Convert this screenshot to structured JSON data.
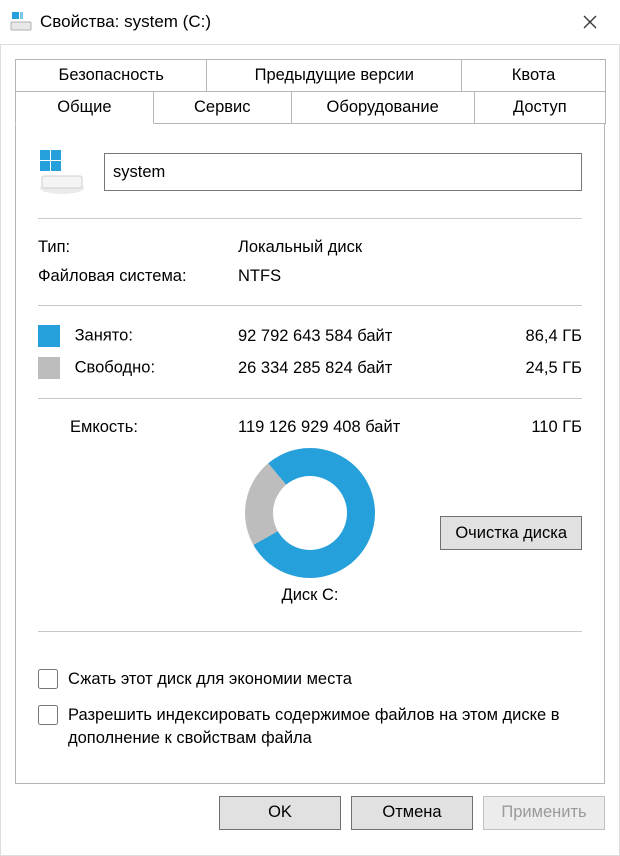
{
  "window": {
    "title": "Свойства: system (C:)"
  },
  "tabs_row1": [
    {
      "label": "Безопасность"
    },
    {
      "label": "Предыдущие версии"
    },
    {
      "label": "Квота"
    }
  ],
  "tabs_row2": [
    {
      "label": "Общие",
      "selected": true
    },
    {
      "label": "Сервис"
    },
    {
      "label": "Оборудование"
    },
    {
      "label": "Доступ"
    }
  ],
  "general": {
    "name_value": "system",
    "type_label": "Тип:",
    "type_value": "Локальный диск",
    "fs_label": "Файловая система:",
    "fs_value": "NTFS",
    "used_label": "Занято:",
    "used_bytes": "92 792 643 584 байт",
    "used_gb": "86,4 ГБ",
    "free_label": "Свободно:",
    "free_bytes": "26 334 285 824 байт",
    "free_gb": "24,5 ГБ",
    "capacity_label": "Емкость:",
    "capacity_bytes": "119 126 929 408 байт",
    "capacity_gb": "110 ГБ",
    "disk_caption": "Диск C:",
    "cleanup_label": "Очистка диска",
    "compress_label": "Сжать этот диск для экономии места",
    "index_label": "Разрешить индексировать содержимое файлов на этом диске в дополнение к свойствам файла"
  },
  "colors": {
    "used": "#26a0da",
    "free": "#bdbdbd"
  },
  "buttons": {
    "ok": "OK",
    "cancel": "Отмена",
    "apply": "Применить"
  },
  "chart_data": {
    "type": "pie",
    "title": "Диск C:",
    "series": [
      {
        "name": "Занято",
        "value": 92792643584,
        "display": "86,4 ГБ",
        "color": "#26a0da"
      },
      {
        "name": "Свободно",
        "value": 26334285824,
        "display": "24,5 ГБ",
        "color": "#bdbdbd"
      }
    ],
    "total": {
      "name": "Емкость",
      "value": 119126929408,
      "display": "110 ГБ"
    }
  }
}
